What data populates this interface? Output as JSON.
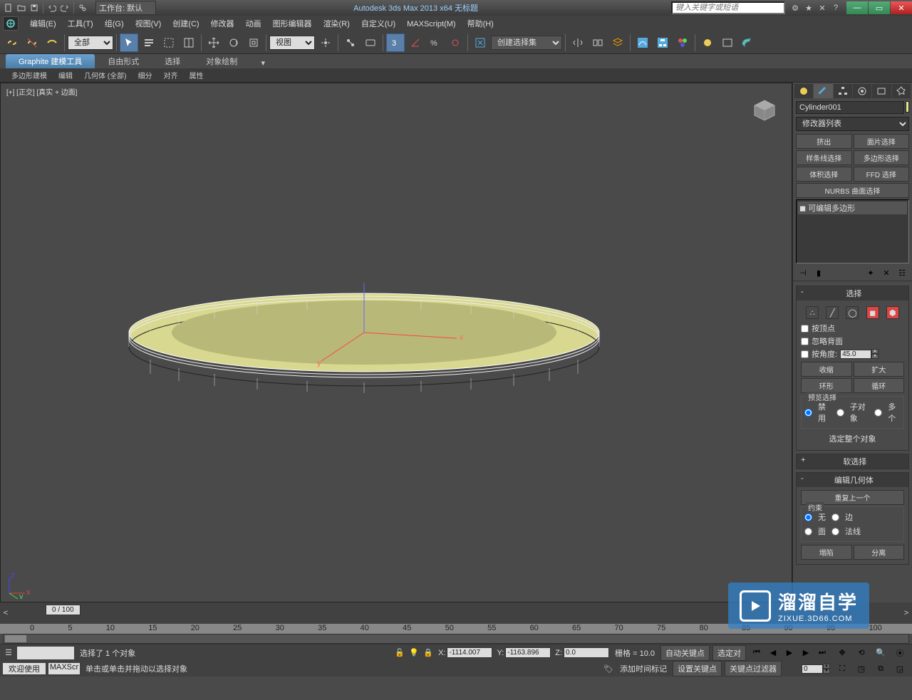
{
  "title_bar": {
    "workspace_label": "工作台: 默认",
    "app_title": "Autodesk 3ds Max  2013 x64     无标题",
    "search_placeholder": "键入关键字或短语"
  },
  "menus": [
    "编辑(E)",
    "工具(T)",
    "组(G)",
    "视图(V)",
    "创建(C)",
    "修改器",
    "动画",
    "图形编辑器",
    "渲染(R)",
    "自定义(U)",
    "MAXScript(M)",
    "帮助(H)"
  ],
  "toolbar": {
    "filter_combo": "全部",
    "view_combo": "视图",
    "set_combo": "创建选择集"
  },
  "ribbon": {
    "tabs": [
      "Graphite 建模工具",
      "自由形式",
      "选择",
      "对象绘制"
    ],
    "subtabs": [
      "多边形建模",
      "编辑",
      "几何体 (全部)",
      "细分",
      "对齐",
      "属性"
    ]
  },
  "viewport": {
    "label": "[+] [正交] [真实 + 边面]",
    "axes": {
      "x": "x",
      "y": "y",
      "z": "z"
    }
  },
  "command_panel": {
    "object_name": "Cylinder001",
    "modifier_list_label": "修改器列表",
    "quick_buttons": [
      "挤出",
      "面片选择",
      "样条线选择",
      "多边形选择",
      "体积选择",
      "FFD 选择"
    ],
    "nurbs_btn": "NURBS 曲面选择",
    "stack_item": "可编辑多边形",
    "rollouts": {
      "selection": {
        "title": "选择",
        "by_vertex": "按顶点",
        "ignore_back": "忽略背面",
        "by_angle": "按角度:",
        "angle_value": "45.0",
        "shrink": "收缩",
        "grow": "扩大",
        "ring": "环形",
        "loop": "循环",
        "preview_label": "预览选择",
        "preview_opts": [
          "禁用",
          "子对象",
          "多个"
        ],
        "select_whole": "选定整个对象"
      },
      "soft_sel": {
        "title": "软选择"
      },
      "edit_geo": {
        "title": "编辑几何体",
        "repeat": "重复上一个",
        "constraint_label": "约束",
        "opts": [
          "无",
          "边",
          "面",
          "法线"
        ]
      },
      "extra": {
        "opt1": "塌陷",
        "opt2": "分离"
      }
    }
  },
  "timeline": {
    "slider_label": "0 / 100",
    "ticks": [
      "0",
      "5",
      "10",
      "15",
      "20",
      "25",
      "30",
      "35",
      "40",
      "45",
      "50",
      "55",
      "60",
      "65",
      "70",
      "75",
      "80",
      "85",
      "90",
      "95",
      "100"
    ]
  },
  "status": {
    "selected_text": "选择了 1 个对象",
    "x": "-1114.007",
    "y": "-1163.896",
    "z": "0.0",
    "grid": "栅格 = 10.0",
    "auto_key": "自动关键点",
    "sel_lock": "选定对",
    "set_key": "设置关键点",
    "key_filter": "关键点过滤器",
    "prompt": "单击或单击并拖动以选择对象",
    "add_marker": "添加时间标记",
    "welcome": "欢迎使用",
    "maxscr": "MAXScr"
  },
  "watermark": {
    "cn": "溜溜自学",
    "url": "ZIXUE.3D66.COM"
  }
}
